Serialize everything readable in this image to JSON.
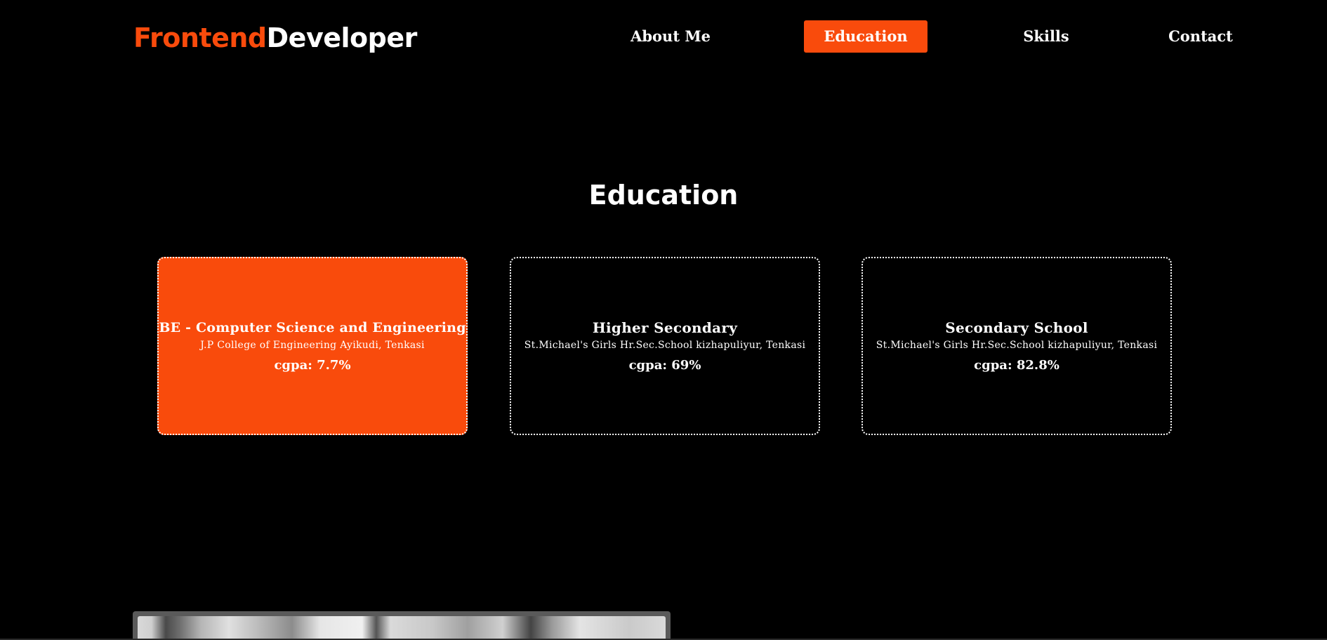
{
  "header": {
    "logo_part1": "Frontend",
    "logo_part2": "Developer",
    "nav": [
      {
        "label": "About Me",
        "active": false
      },
      {
        "label": "Education",
        "active": true
      },
      {
        "label": "Skills",
        "active": false
      },
      {
        "label": "Contact",
        "active": false
      }
    ]
  },
  "education": {
    "title": "Education",
    "cards": [
      {
        "degree": "BE - Computer Science and Engineering",
        "institution": "J.P College of Engineering Ayikudi, Tenkasi",
        "score": "cgpa: 7.7%",
        "active": true
      },
      {
        "degree": "Higher Secondary",
        "institution": "St.Michael's Girls Hr.Sec.School kizhapuliyur, Tenkasi",
        "score": "cgpa: 69%",
        "active": false
      },
      {
        "degree": "Secondary School",
        "institution": "St.Michael's Girls Hr.Sec.School kizhapuliyur, Tenkasi",
        "score": "cgpa: 82.8%",
        "active": false
      }
    ]
  },
  "colors": {
    "accent": "#f94b0c",
    "background": "#000000",
    "text": "#ffffff"
  }
}
